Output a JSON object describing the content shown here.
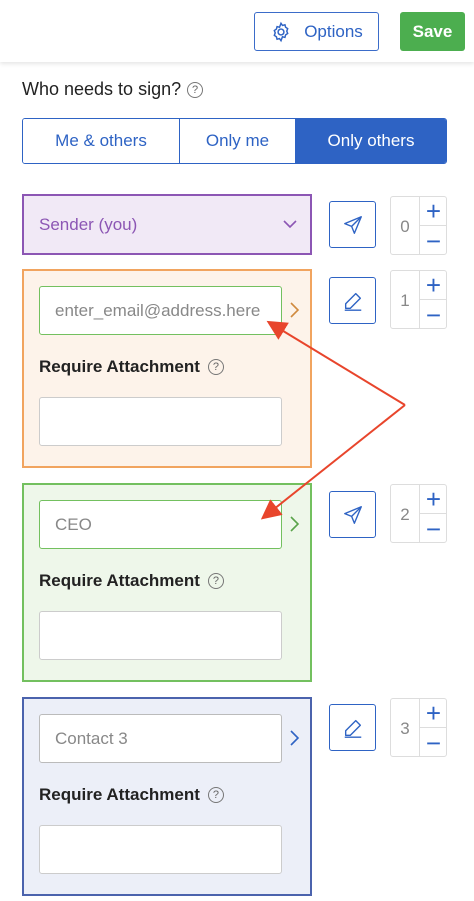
{
  "header": {
    "options_label": "Options",
    "save_label": "Save",
    "save_color": "#4cae4f",
    "accent_color": "#2e63c4"
  },
  "who": {
    "label": "Who needs to sign?",
    "help": "?"
  },
  "segmented": {
    "options": [
      "Me & others",
      "Only me",
      "Only others"
    ],
    "selected": "Only others"
  },
  "sender": {
    "label": "Sender (you)",
    "order": "0",
    "action_icon": "send-icon"
  },
  "signers": [
    {
      "email_placeholder": "enter_email@address.here",
      "require_label": "Require Attachment",
      "order": "1",
      "action_icon": "pen-icon",
      "color": "#f1a45f"
    },
    {
      "email_value": "CEO",
      "require_label": "Require Attachment",
      "order": "2",
      "action_icon": "send-icon",
      "color": "#73c05f"
    },
    {
      "email_value": "Contact 3",
      "require_label": "Require Attachment",
      "order": "3",
      "action_icon": "pen-icon",
      "color": "#4b63ad"
    }
  ],
  "counter": {
    "plus": "+",
    "minus": "−"
  },
  "annotation_color": "#e8452c"
}
